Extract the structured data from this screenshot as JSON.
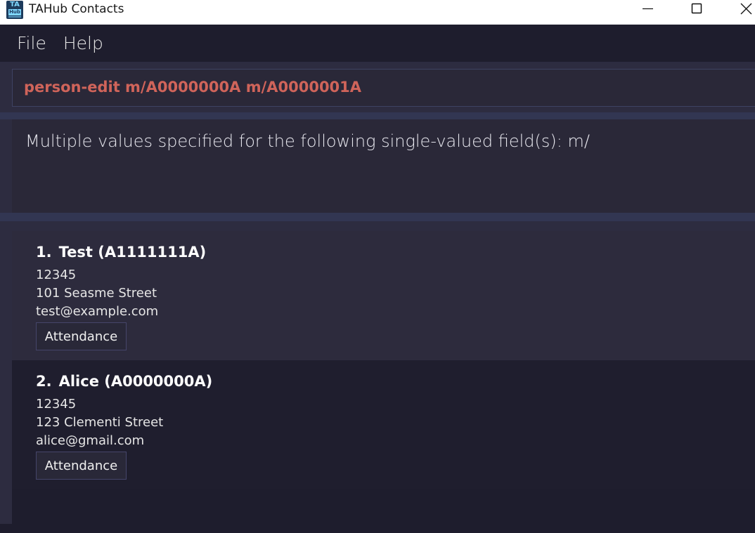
{
  "window": {
    "title": "TAHub Contacts",
    "icon_text_top": "TA",
    "icon_text_bottom": "Hub"
  },
  "menu": {
    "items": [
      "File",
      "Help"
    ]
  },
  "command": {
    "value": "person-edit m/A0000000A m/A0000001A",
    "color": "#d0645a"
  },
  "result": {
    "message": "Multiple values specified for the following single-valued field(s): m/"
  },
  "persons": [
    {
      "index": "1.",
      "name": "Test",
      "matric": "(A1111111A)",
      "phone": "12345",
      "address": "101 Seasme Street",
      "email": "test@example.com",
      "button": "Attendance"
    },
    {
      "index": "2.",
      "name": "Alice",
      "matric": "(A0000000A)",
      "phone": "12345",
      "address": "123 Clementi Street",
      "email": "alice@gmail.com",
      "button": "Attendance"
    }
  ],
  "colors": {
    "background": "#1e1d2d",
    "panel": "#2a2838",
    "divider": "#323652"
  }
}
